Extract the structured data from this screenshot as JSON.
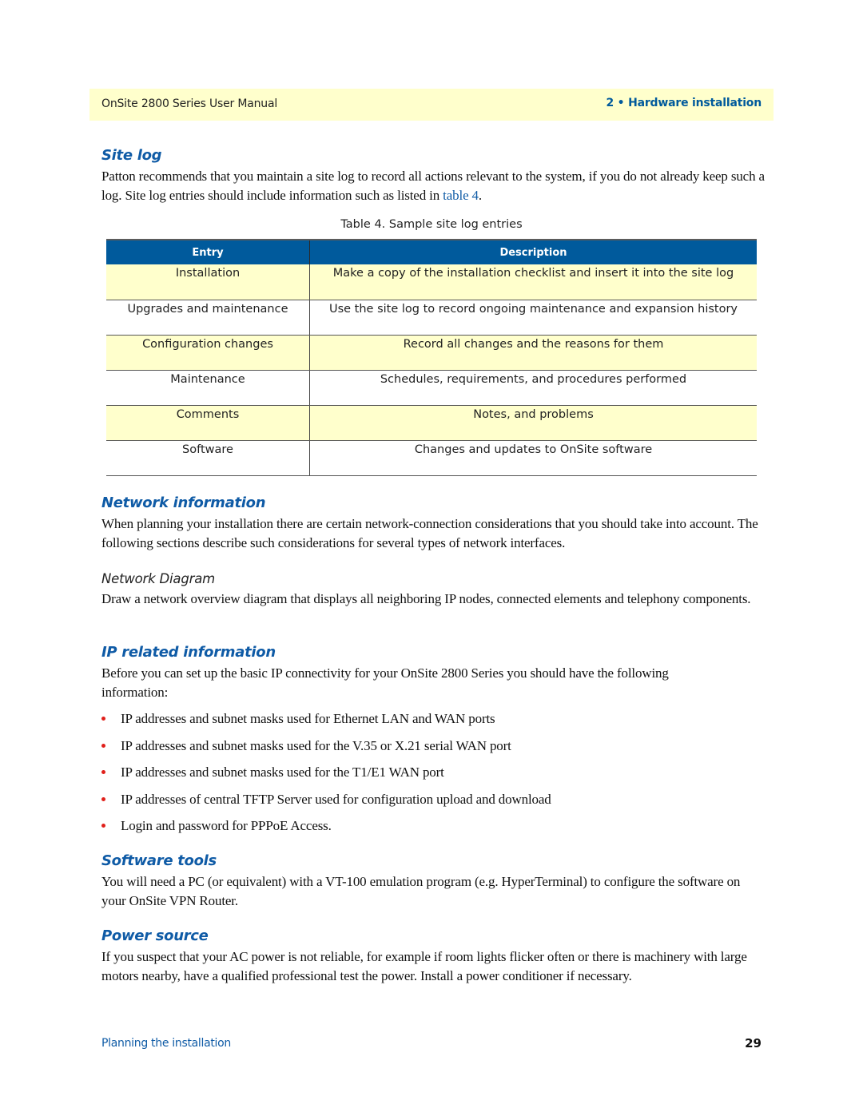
{
  "header": {
    "manual_title": "OnSite 2800 Series User Manual",
    "chapter": "2 • Hardware installation"
  },
  "site_log": {
    "heading": "Site log",
    "paragraph_before_link": "Patton recommends that you maintain a site log to record all actions relevant to the system, if you do not already keep such a log. Site log entries should include information such as listed in ",
    "link_text": "table 4",
    "paragraph_after_link": ".",
    "table": {
      "caption": "Table 4. Sample site log entries",
      "columns": [
        "Entry",
        "Description"
      ],
      "rows": [
        {
          "entry": "Installation",
          "description": "Make a copy of the installation checklist and insert it into the site log"
        },
        {
          "entry": "Upgrades and maintenance",
          "description": "Use the site log to record ongoing maintenance and expansion history"
        },
        {
          "entry": "Configuration changes",
          "description": "Record all changes and the reasons for them"
        },
        {
          "entry": "Maintenance",
          "description": "Schedules, requirements, and procedures performed"
        },
        {
          "entry": "Comments",
          "description": "Notes, and problems"
        },
        {
          "entry": "Software",
          "description": "Changes and updates to OnSite software"
        }
      ]
    }
  },
  "network_information": {
    "heading": "Network information",
    "paragraph": "When planning your installation there are certain network-connection considerations that you should take into account. The following sections describe such considerations for several types of network interfaces.",
    "subheading": "Network Diagram",
    "sub_paragraph": "Draw a network overview diagram that displays all neighboring IP nodes, connected elements and telephony components."
  },
  "ip_related": {
    "heading": "IP related information",
    "paragraph": "Before you can set up the basic IP connectivity for your OnSite 2800 Series you should have the following information:",
    "bullets": [
      "IP addresses and subnet masks used for Ethernet LAN and WAN ports",
      "IP addresses and subnet masks used for the V.35 or X.21 serial WAN port",
      "IP addresses and subnet masks used for the T1/E1 WAN port",
      "IP addresses of central TFTP Server used for configuration upload and download",
      "Login and password for PPPoE Access."
    ]
  },
  "software_tools": {
    "heading": "Software tools",
    "paragraph": "You will need a PC (or equivalent) with a VT-100 emulation program (e.g. HyperTerminal) to configure the software on your OnSite VPN Router."
  },
  "power_source": {
    "heading": "Power source",
    "paragraph": "If you suspect that your AC power is not reliable, for example if room lights flicker often or there is machinery with large motors nearby, have a qualified professional test the power. Install a power conditioner if necessary."
  },
  "footer": {
    "section": "Planning the installation",
    "page_number": "29"
  },
  "colors": {
    "accent_blue": "#0f5ba6",
    "table_header_blue": "#005a9c",
    "highlight_yellow": "#ffffcc",
    "bullet_red": "#e0201b"
  }
}
